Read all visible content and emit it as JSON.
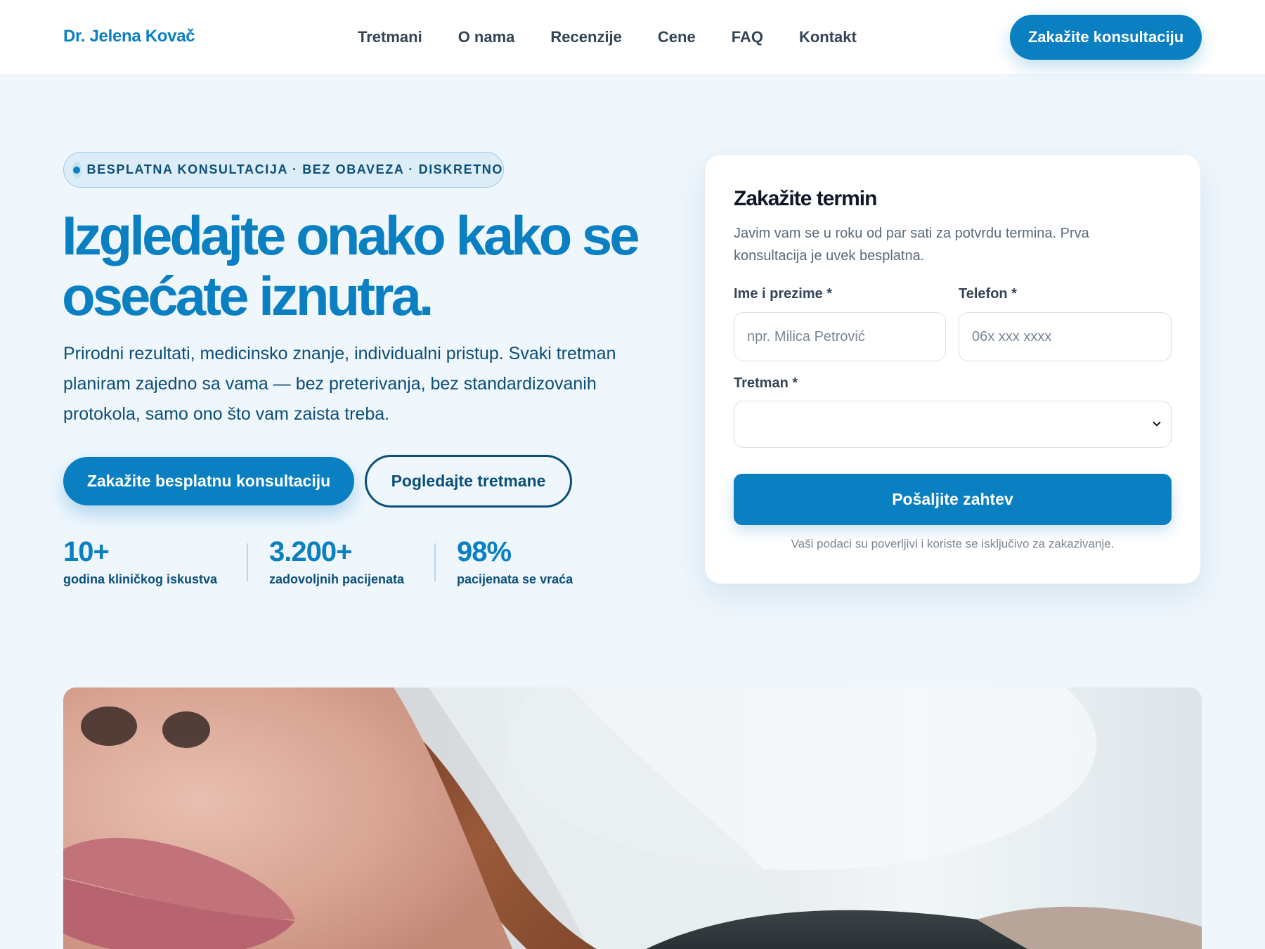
{
  "header": {
    "brand": "Dr. Jelena Kovač",
    "nav": [
      "Tretmani",
      "O nama",
      "Recenzije",
      "Cene",
      "FAQ",
      "Kontakt"
    ],
    "cta": "Zakažite konsultaciju"
  },
  "hero": {
    "badge": "BESPLATNA KONSULTACIJA · BEZ OBAVEZA · DISKRETNO",
    "title": "Izgledajte onako kako se osećate iznutra.",
    "subtitle": "Prirodni rezultati, medicinsko znanje, individualni pristup. Svaki tretman planiram zajedno sa vama — bez preterivanja, bez standardizovanih protokola, samo ono što vam zaista treba.",
    "primary_button": "Zakažite besplatnu konsultaciju",
    "secondary_button": "Pogledajte tretmane",
    "stats": [
      {
        "value": "10+",
        "label": "godina kliničkog iskustva"
      },
      {
        "value": "3.200+",
        "label": "zadovoljnih pacijenata"
      },
      {
        "value": "98%",
        "label": "pacijenata se vraća"
      }
    ]
  },
  "form": {
    "title": "Zakažite termin",
    "description": "Javim vam se u roku od par sati za potvrdu termina. Prva konsultacija je uvek besplatna.",
    "name_label": "Ime i prezime *",
    "name_placeholder": "npr. Milica Petrović",
    "phone_label": "Telefon *",
    "phone_placeholder": "06x xxx xxxx",
    "treatment_label": "Tretman *",
    "treatment_value": "",
    "submit": "Pošaljite zahtev",
    "privacy": "Vaši podaci su poverljivi i koriste se isključivo za zakazivanje."
  },
  "colors": {
    "accent": "#0a7fc2",
    "dark_blue": "#0b4f78",
    "background": "#eff7fd"
  },
  "icons": [
    "chevron-down-icon",
    "badge-dot-icon"
  ]
}
